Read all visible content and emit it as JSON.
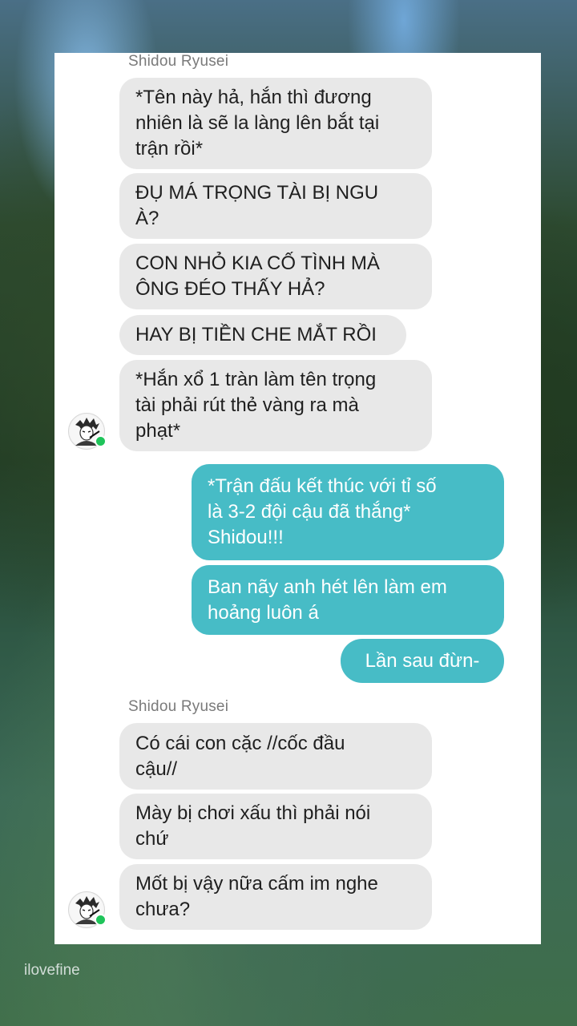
{
  "colors": {
    "incoming_bubble": "#e8e8e8",
    "outgoing_bubble": "#47bcc6",
    "online_dot": "#1fc45a"
  },
  "groups": [
    {
      "sender": "Shidou Ryusei",
      "messages": [
        "*Tên này hả, hắn thì đương\nnhiên là sẽ la làng lên bắt tại\ntrận rồi*",
        "ĐỤ MÁ TRỌNG TÀI BỊ NGU\nÀ?",
        "CON NHỎ KIA CỐ TÌNH MÀ\nÔNG ĐÉO THẤY HẢ?",
        "HAY BỊ TIỀN CHE MẮT RỒI",
        "*Hắn xổ 1 tràn làm tên trọng\ntài phải rút thẻ vàng ra mà\nphạt*"
      ],
      "avatar_icon": "anime-character-avatar-icon"
    },
    {
      "sender": "",
      "messages": [
        "*Trận đấu kết thúc với tỉ số\nlà 3-2 đội cậu đã thắng*\nShidou!!!",
        "Ban nãy anh hét lên làm em\nhoảng luôn á",
        "Lần sau đừn-"
      ]
    },
    {
      "sender": "Shidou Ryusei",
      "messages": [
        "Có cái con cặc //cốc đầu\ncậu//",
        "Mày bị chơi xấu thì phải nói\nchứ",
        "Mốt bị vậy nữa cấm im nghe\nchưa?"
      ],
      "avatar_icon": "anime-character-avatar-icon"
    }
  ],
  "watermark": "ilovefine"
}
